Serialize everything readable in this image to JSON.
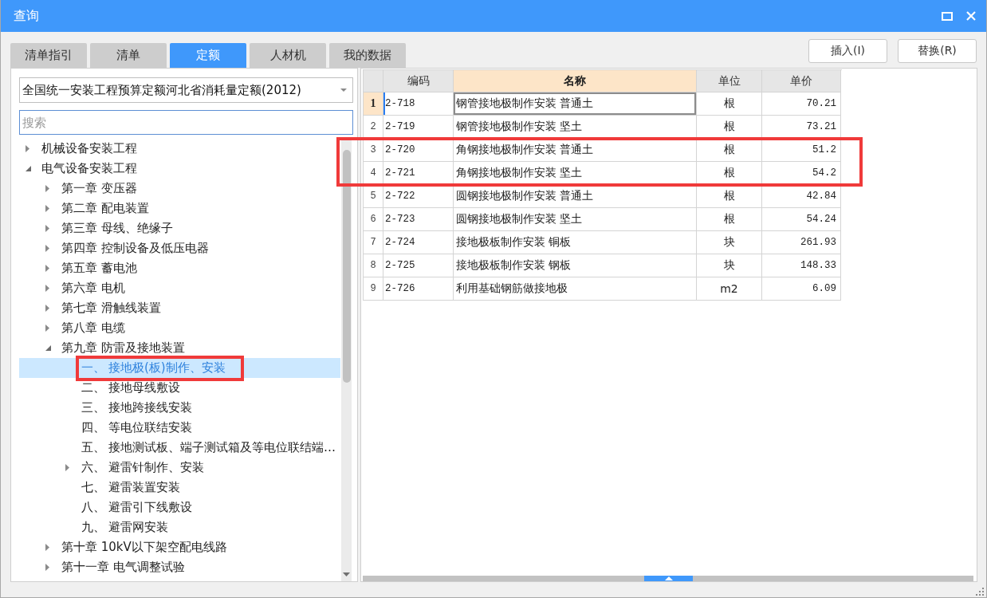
{
  "window": {
    "title": "查询"
  },
  "tabs": [
    {
      "label": "清单指引",
      "selected": false
    },
    {
      "label": "清单",
      "selected": false
    },
    {
      "label": "定额",
      "selected": true
    },
    {
      "label": "人材机",
      "selected": false
    },
    {
      "label": "我的数据",
      "selected": false
    }
  ],
  "buttons": [
    {
      "label": "插入(I)"
    },
    {
      "label": "替换(R)"
    }
  ],
  "library_select": {
    "value": "全国统一安装工程预算定额河北省消耗量定额(2012)"
  },
  "search": {
    "placeholder": "搜索"
  },
  "tree": [
    {
      "label": "机械设备安装工程",
      "expanded": false,
      "selected": false,
      "marked": false
    },
    {
      "label": "电气设备安装工程",
      "expanded": true,
      "selected": false,
      "marked": false,
      "children": [
        {
          "label": "第一章 变压器",
          "expanded": false,
          "selected": false,
          "marked": false
        },
        {
          "label": "第二章 配电装置",
          "expanded": false,
          "selected": false,
          "marked": false
        },
        {
          "label": "第三章 母线、绝缘子",
          "expanded": false,
          "selected": false,
          "marked": false
        },
        {
          "label": "第四章 控制设备及低压电器",
          "expanded": false,
          "selected": false,
          "marked": false
        },
        {
          "label": "第五章 蓄电池",
          "expanded": false,
          "selected": false,
          "marked": false
        },
        {
          "label": "第六章 电机",
          "expanded": false,
          "selected": false,
          "marked": false
        },
        {
          "label": "第七章 滑触线装置",
          "expanded": false,
          "selected": false,
          "marked": false
        },
        {
          "label": "第八章 电缆",
          "expanded": false,
          "selected": false,
          "marked": false
        },
        {
          "label": "第九章 防雷及接地装置",
          "expanded": true,
          "selected": false,
          "marked": false,
          "children": [
            {
              "number": "一、",
              "label": "接地极(板)制作、安装",
              "selected": true,
              "marked": true
            },
            {
              "number": "二、",
              "label": "接地母线敷设",
              "selected": false,
              "marked": false
            },
            {
              "number": "三、",
              "label": "接地跨接线安装",
              "selected": false,
              "marked": false
            },
            {
              "number": "四、",
              "label": "等电位联结安装",
              "selected": false,
              "marked": false
            },
            {
              "number": "五、",
              "label": "接地测试板、端子测试箱及等电位联结端…",
              "selected": false,
              "marked": false
            },
            {
              "number": "六、",
              "label": "避雷针制作、安装",
              "expanded": false,
              "selected": false,
              "marked": false
            },
            {
              "number": "七、",
              "label": "避雷装置安装",
              "selected": false,
              "marked": false
            },
            {
              "number": "八、",
              "label": "避雷引下线敷设",
              "selected": false,
              "marked": false
            },
            {
              "number": "九、",
              "label": "避雷网安装",
              "selected": false,
              "marked": false
            }
          ]
        },
        {
          "label": "第十章 10kV以下架空配电线路",
          "expanded": false,
          "selected": false,
          "marked": false
        },
        {
          "label": "第十一章 电气调整试验",
          "expanded": false,
          "selected": false,
          "marked": false
        }
      ]
    }
  ],
  "table": {
    "columns": [
      {
        "label": "编码",
        "selected": false
      },
      {
        "label": "名称",
        "selected": true
      },
      {
        "label": "单位",
        "selected": false
      },
      {
        "label": "单价",
        "selected": false
      }
    ],
    "rows": [
      {
        "number": "1",
        "code": "2-718",
        "name": "钢管接地极制作安装 普通土",
        "unit": "根",
        "price": "70.21",
        "selected": true,
        "marked": false
      },
      {
        "number": "2",
        "code": "2-719",
        "name": "钢管接地极制作安装 坚土",
        "unit": "根",
        "price": "73.21",
        "selected": false,
        "marked": false
      },
      {
        "number": "3",
        "code": "2-720",
        "name": "角钢接地极制作安装 普通土",
        "unit": "根",
        "price": "51.2",
        "selected": false,
        "marked": true
      },
      {
        "number": "4",
        "code": "2-721",
        "name": "角钢接地极制作安装 坚土",
        "unit": "根",
        "price": "54.2",
        "selected": false,
        "marked": true
      },
      {
        "number": "5",
        "code": "2-722",
        "name": "圆钢接地极制作安装 普通土",
        "unit": "根",
        "price": "42.84",
        "selected": false,
        "marked": false
      },
      {
        "number": "6",
        "code": "2-723",
        "name": "圆钢接地极制作安装 坚土",
        "unit": "根",
        "price": "54.24",
        "selected": false,
        "marked": false
      },
      {
        "number": "7",
        "code": "2-724",
        "name": "接地极板制作安装 铜板",
        "unit": "块",
        "price": "261.93",
        "selected": false,
        "marked": false
      },
      {
        "number": "8",
        "code": "2-725",
        "name": "接地极板制作安装 钢板",
        "unit": "块",
        "price": "148.33",
        "selected": false,
        "marked": false
      },
      {
        "number": "9",
        "code": "2-726",
        "name": "利用基础钢筋做接地极",
        "unit": "m2",
        "price": "6.09",
        "selected": false,
        "marked": false
      }
    ]
  }
}
